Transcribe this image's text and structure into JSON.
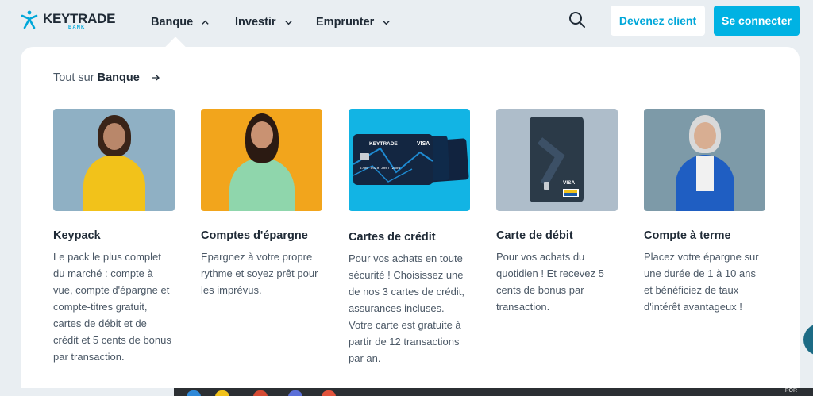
{
  "brand": {
    "name": "KEYTRADE",
    "sub": "BANK",
    "accent": "#00b2e3"
  },
  "nav": {
    "items": [
      {
        "label": "Banque",
        "icon": "chevron-up-icon"
      },
      {
        "label": "Investir",
        "icon": "chevron-down-icon"
      },
      {
        "label": "Emprunter",
        "icon": "chevron-down-icon"
      }
    ],
    "search_icon": "search-icon",
    "cta_client": "Devenez client",
    "cta_connect": "Se connecter"
  },
  "dropdown": {
    "all_prefix": "Tout sur",
    "all_label": "Banque",
    "cards": [
      {
        "title": "Keypack",
        "desc": "Le pack le plus complet du marché : compte à vue, compte d'épargne et compte-titres gratuit, cartes de débit et de crédit et 5 cents de bonus par transaction."
      },
      {
        "title": "Comptes d'épargne",
        "desc": "Epargnez à votre propre rythme et soyez prêt pour les imprévus."
      },
      {
        "title": "Cartes de crédit",
        "desc": "Pour vos achats en toute sécurité ! Choisissez une de nos 3 cartes de crédit, assurances incluses. Votre carte est gratuite à partir de 12 transactions par an."
      },
      {
        "title": "Carte de débit",
        "desc": "Pour vos achats du quotidien ! Et recevez 5 cents de bonus par transaction."
      },
      {
        "title": "Compte à terme",
        "desc": "Placez votre épargne sur une durée de 1 à 10 ans et bénéficiez de taux d'intérêt avantageux !"
      }
    ]
  },
  "card_art": {
    "brand": "KEYTRADE",
    "network": "VISA",
    "number": "4796 5629 3087 2808"
  },
  "taskbar": {
    "lang": "POR"
  }
}
